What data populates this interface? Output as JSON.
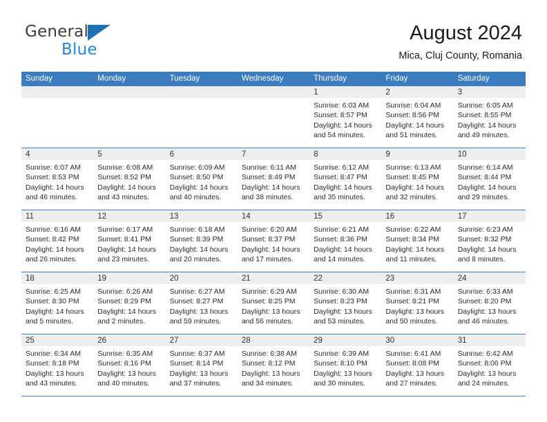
{
  "brand": {
    "name_part1": "General",
    "name_part2": "Blue",
    "accent_color": "#2288dd",
    "triangle_color": "#1f6fb5"
  },
  "header": {
    "title": "August 2024",
    "location": "Mica, Cluj County, Romania"
  },
  "calendar": {
    "header_bg_color": "#3b7cc0",
    "day_band_color": "#eeeeee",
    "weekdays": [
      "Sunday",
      "Monday",
      "Tuesday",
      "Wednesday",
      "Thursday",
      "Friday",
      "Saturday"
    ],
    "weeks": [
      [
        {
          "day": "",
          "sunrise": "",
          "sunset": "",
          "daylight1": "",
          "daylight2": ""
        },
        {
          "day": "",
          "sunrise": "",
          "sunset": "",
          "daylight1": "",
          "daylight2": ""
        },
        {
          "day": "",
          "sunrise": "",
          "sunset": "",
          "daylight1": "",
          "daylight2": ""
        },
        {
          "day": "",
          "sunrise": "",
          "sunset": "",
          "daylight1": "",
          "daylight2": ""
        },
        {
          "day": "1",
          "sunrise": "Sunrise: 6:03 AM",
          "sunset": "Sunset: 8:57 PM",
          "daylight1": "Daylight: 14 hours",
          "daylight2": "and 54 minutes."
        },
        {
          "day": "2",
          "sunrise": "Sunrise: 6:04 AM",
          "sunset": "Sunset: 8:56 PM",
          "daylight1": "Daylight: 14 hours",
          "daylight2": "and 51 minutes."
        },
        {
          "day": "3",
          "sunrise": "Sunrise: 6:05 AM",
          "sunset": "Sunset: 8:55 PM",
          "daylight1": "Daylight: 14 hours",
          "daylight2": "and 49 minutes."
        }
      ],
      [
        {
          "day": "4",
          "sunrise": "Sunrise: 6:07 AM",
          "sunset": "Sunset: 8:53 PM",
          "daylight1": "Daylight: 14 hours",
          "daylight2": "and 46 minutes."
        },
        {
          "day": "5",
          "sunrise": "Sunrise: 6:08 AM",
          "sunset": "Sunset: 8:52 PM",
          "daylight1": "Daylight: 14 hours",
          "daylight2": "and 43 minutes."
        },
        {
          "day": "6",
          "sunrise": "Sunrise: 6:09 AM",
          "sunset": "Sunset: 8:50 PM",
          "daylight1": "Daylight: 14 hours",
          "daylight2": "and 40 minutes."
        },
        {
          "day": "7",
          "sunrise": "Sunrise: 6:11 AM",
          "sunset": "Sunset: 8:49 PM",
          "daylight1": "Daylight: 14 hours",
          "daylight2": "and 38 minutes."
        },
        {
          "day": "8",
          "sunrise": "Sunrise: 6:12 AM",
          "sunset": "Sunset: 8:47 PM",
          "daylight1": "Daylight: 14 hours",
          "daylight2": "and 35 minutes."
        },
        {
          "day": "9",
          "sunrise": "Sunrise: 6:13 AM",
          "sunset": "Sunset: 8:45 PM",
          "daylight1": "Daylight: 14 hours",
          "daylight2": "and 32 minutes."
        },
        {
          "day": "10",
          "sunrise": "Sunrise: 6:14 AM",
          "sunset": "Sunset: 8:44 PM",
          "daylight1": "Daylight: 14 hours",
          "daylight2": "and 29 minutes."
        }
      ],
      [
        {
          "day": "11",
          "sunrise": "Sunrise: 6:16 AM",
          "sunset": "Sunset: 8:42 PM",
          "daylight1": "Daylight: 14 hours",
          "daylight2": "and 26 minutes."
        },
        {
          "day": "12",
          "sunrise": "Sunrise: 6:17 AM",
          "sunset": "Sunset: 8:41 PM",
          "daylight1": "Daylight: 14 hours",
          "daylight2": "and 23 minutes."
        },
        {
          "day": "13",
          "sunrise": "Sunrise: 6:18 AM",
          "sunset": "Sunset: 8:39 PM",
          "daylight1": "Daylight: 14 hours",
          "daylight2": "and 20 minutes."
        },
        {
          "day": "14",
          "sunrise": "Sunrise: 6:20 AM",
          "sunset": "Sunset: 8:37 PM",
          "daylight1": "Daylight: 14 hours",
          "daylight2": "and 17 minutes."
        },
        {
          "day": "15",
          "sunrise": "Sunrise: 6:21 AM",
          "sunset": "Sunset: 8:36 PM",
          "daylight1": "Daylight: 14 hours",
          "daylight2": "and 14 minutes."
        },
        {
          "day": "16",
          "sunrise": "Sunrise: 6:22 AM",
          "sunset": "Sunset: 8:34 PM",
          "daylight1": "Daylight: 14 hours",
          "daylight2": "and 11 minutes."
        },
        {
          "day": "17",
          "sunrise": "Sunrise: 6:23 AM",
          "sunset": "Sunset: 8:32 PM",
          "daylight1": "Daylight: 14 hours",
          "daylight2": "and 8 minutes."
        }
      ],
      [
        {
          "day": "18",
          "sunrise": "Sunrise: 6:25 AM",
          "sunset": "Sunset: 8:30 PM",
          "daylight1": "Daylight: 14 hours",
          "daylight2": "and 5 minutes."
        },
        {
          "day": "19",
          "sunrise": "Sunrise: 6:26 AM",
          "sunset": "Sunset: 8:29 PM",
          "daylight1": "Daylight: 14 hours",
          "daylight2": "and 2 minutes."
        },
        {
          "day": "20",
          "sunrise": "Sunrise: 6:27 AM",
          "sunset": "Sunset: 8:27 PM",
          "daylight1": "Daylight: 13 hours",
          "daylight2": "and 59 minutes."
        },
        {
          "day": "21",
          "sunrise": "Sunrise: 6:29 AM",
          "sunset": "Sunset: 8:25 PM",
          "daylight1": "Daylight: 13 hours",
          "daylight2": "and 56 minutes."
        },
        {
          "day": "22",
          "sunrise": "Sunrise: 6:30 AM",
          "sunset": "Sunset: 8:23 PM",
          "daylight1": "Daylight: 13 hours",
          "daylight2": "and 53 minutes."
        },
        {
          "day": "23",
          "sunrise": "Sunrise: 6:31 AM",
          "sunset": "Sunset: 8:21 PM",
          "daylight1": "Daylight: 13 hours",
          "daylight2": "and 50 minutes."
        },
        {
          "day": "24",
          "sunrise": "Sunrise: 6:33 AM",
          "sunset": "Sunset: 8:20 PM",
          "daylight1": "Daylight: 13 hours",
          "daylight2": "and 46 minutes."
        }
      ],
      [
        {
          "day": "25",
          "sunrise": "Sunrise: 6:34 AM",
          "sunset": "Sunset: 8:18 PM",
          "daylight1": "Daylight: 13 hours",
          "daylight2": "and 43 minutes."
        },
        {
          "day": "26",
          "sunrise": "Sunrise: 6:35 AM",
          "sunset": "Sunset: 8:16 PM",
          "daylight1": "Daylight: 13 hours",
          "daylight2": "and 40 minutes."
        },
        {
          "day": "27",
          "sunrise": "Sunrise: 6:37 AM",
          "sunset": "Sunset: 8:14 PM",
          "daylight1": "Daylight: 13 hours",
          "daylight2": "and 37 minutes."
        },
        {
          "day": "28",
          "sunrise": "Sunrise: 6:38 AM",
          "sunset": "Sunset: 8:12 PM",
          "daylight1": "Daylight: 13 hours",
          "daylight2": "and 34 minutes."
        },
        {
          "day": "29",
          "sunrise": "Sunrise: 6:39 AM",
          "sunset": "Sunset: 8:10 PM",
          "daylight1": "Daylight: 13 hours",
          "daylight2": "and 30 minutes."
        },
        {
          "day": "30",
          "sunrise": "Sunrise: 6:41 AM",
          "sunset": "Sunset: 8:08 PM",
          "daylight1": "Daylight: 13 hours",
          "daylight2": "and 27 minutes."
        },
        {
          "day": "31",
          "sunrise": "Sunrise: 6:42 AM",
          "sunset": "Sunset: 8:06 PM",
          "daylight1": "Daylight: 13 hours",
          "daylight2": "and 24 minutes."
        }
      ]
    ]
  }
}
